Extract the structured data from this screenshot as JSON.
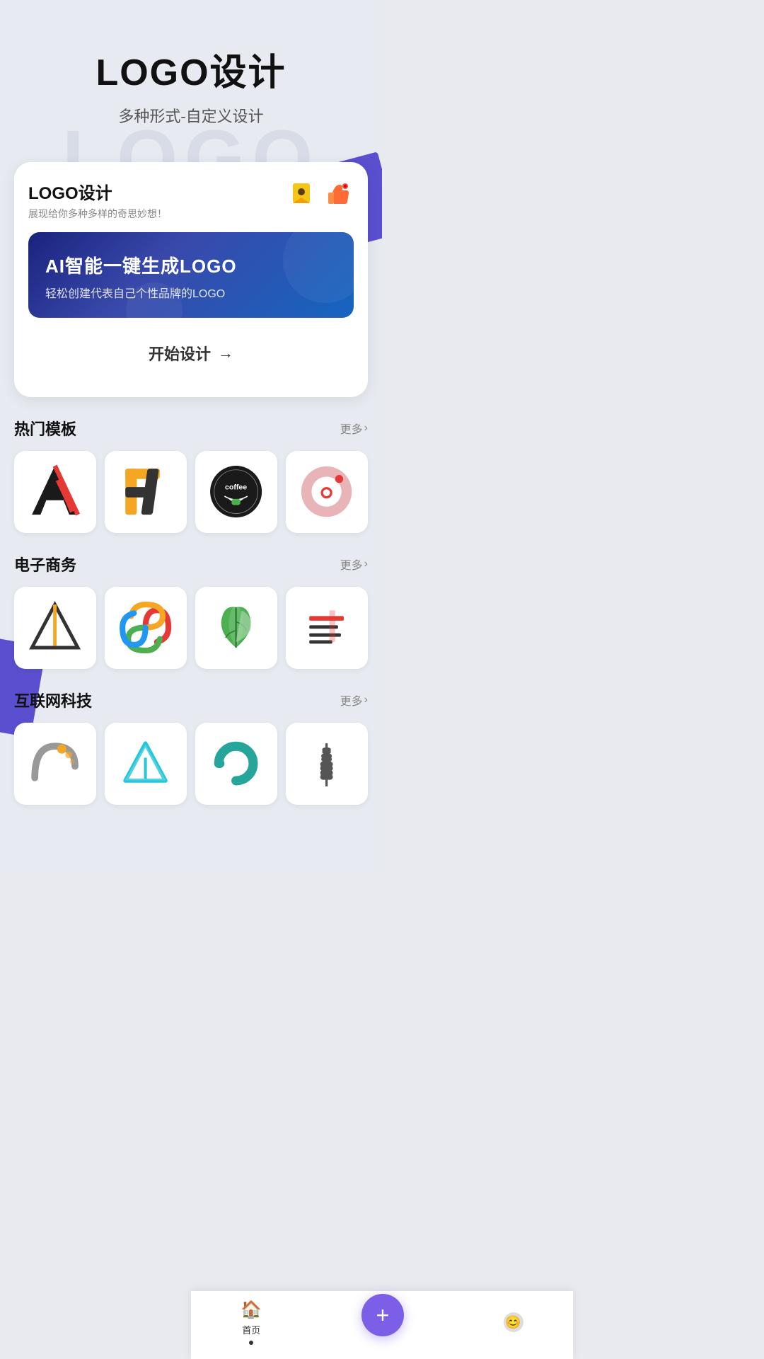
{
  "page": {
    "bg_text": "LOGO",
    "header": {
      "main_title": "LOGO设计",
      "sub_title": "多种形式-自定义设计"
    },
    "card": {
      "title": "LOGO设计",
      "subtitle": "展现给你多种多样的奇思妙想！",
      "badge_icon": "🏷️",
      "thumb_icon": "👍",
      "ai_banner": {
        "title": "AI智能一键生成LOGO",
        "desc": "轻松创建代表自己个性品牌的LOGO",
        "btn_label": "开始设计",
        "btn_arrow": "→"
      }
    },
    "sections": [
      {
        "id": "hot",
        "title": "热门模板",
        "more_label": "更多",
        "logos": [
          {
            "id": "logo-a",
            "type": "letter-a"
          },
          {
            "id": "logo-f",
            "type": "letter-f"
          },
          {
            "id": "logo-coffee",
            "type": "coffee"
          },
          {
            "id": "logo-u",
            "type": "circle-u"
          }
        ]
      },
      {
        "id": "ecommerce",
        "title": "电子商务",
        "more_label": "更多",
        "logos": [
          {
            "id": "logo-triangle",
            "type": "triangle"
          },
          {
            "id": "logo-spiral",
            "type": "spiral"
          },
          {
            "id": "logo-leaf",
            "type": "leaf"
          },
          {
            "id": "logo-lines",
            "type": "lines"
          }
        ]
      },
      {
        "id": "internet",
        "title": "互联网科技",
        "more_label": "更多",
        "logos": [
          {
            "id": "logo-arc-dots",
            "type": "arc-dots"
          },
          {
            "id": "logo-tri2",
            "type": "triangle2"
          },
          {
            "id": "logo-circle-teal",
            "type": "circle-teal"
          },
          {
            "id": "logo-wheat",
            "type": "wheat"
          }
        ]
      }
    ],
    "bottom_nav": {
      "home_label": "首页",
      "add_label": "+",
      "avatar_icon": "😊"
    }
  }
}
